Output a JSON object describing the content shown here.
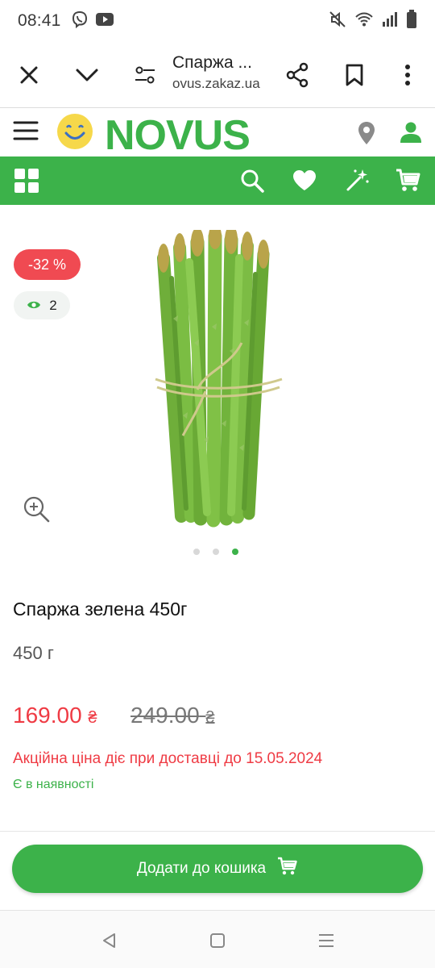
{
  "status_bar": {
    "time": "08:41",
    "left_icons": [
      "viber-icon",
      "youtube-icon"
    ],
    "right_icons": [
      "mute-icon",
      "wifi-icon",
      "signal-icon",
      "battery-icon"
    ]
  },
  "browser": {
    "title": "Спаржа ...",
    "url": "ovus.zakaz.ua"
  },
  "header": {
    "logo_text": "NOVUS"
  },
  "product": {
    "discount_badge": "-32 %",
    "views_count": "2",
    "title": "Спаржа зелена 450г",
    "weight": "450 г",
    "price_new": "169.00",
    "price_old": "249.00",
    "currency": "₴",
    "promo_note": "Акційна ціна діє при доставці до 15.05.2024",
    "stock_note": "Є в наявності",
    "gallery_dots": 3,
    "gallery_active_index": 2
  },
  "cart_button": {
    "label": "Додати до кошика"
  },
  "colors": {
    "brand_green": "#3cb24a",
    "sale_red": "#ef3b44",
    "smile_yellow": "#f6d84a"
  }
}
